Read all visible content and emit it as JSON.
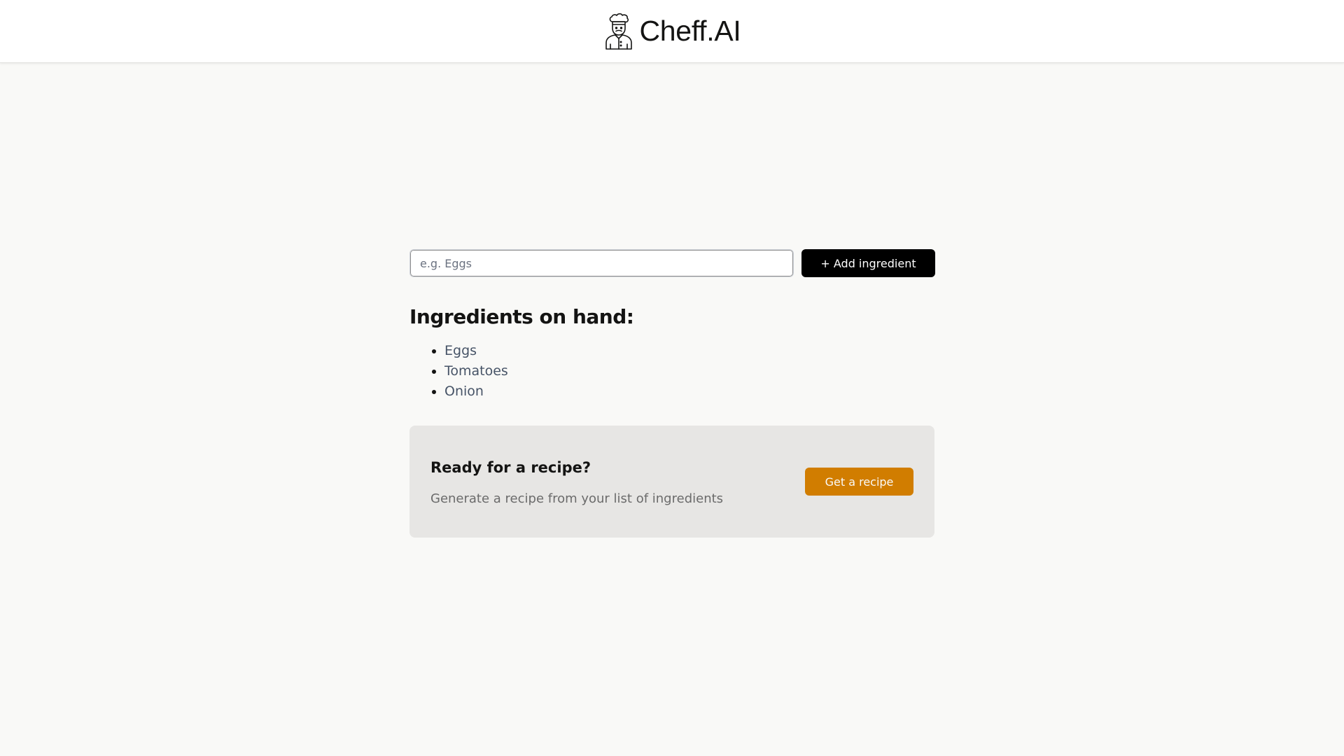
{
  "header": {
    "logo_icon": "chef-icon",
    "brand_name": "Cheff.AI"
  },
  "form": {
    "input_placeholder": "e.g. Eggs",
    "input_value": "",
    "add_button_label": "+ Add ingredient"
  },
  "ingredients": {
    "heading": "Ingredients on hand:",
    "items": [
      "Eggs",
      "Tomatoes",
      "Onion"
    ]
  },
  "recipe_card": {
    "title": "Ready for a recipe?",
    "subtitle": "Generate a recipe from your list of ingredients",
    "button_label": "Get a recipe"
  },
  "colors": {
    "page_background": "#f9f9f7",
    "header_background": "#ffffff",
    "add_button": "#000000",
    "recipe_button": "#d17d00",
    "card_background": "#e7e6e4"
  }
}
